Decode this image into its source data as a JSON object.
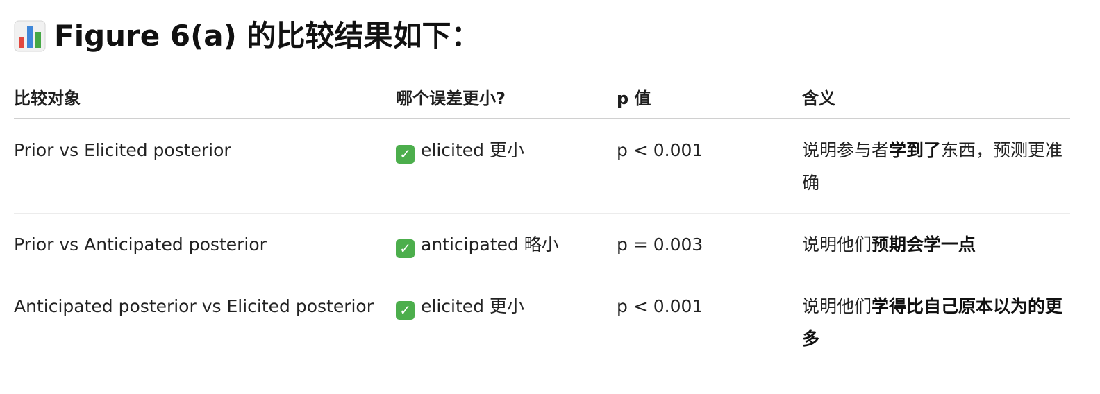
{
  "heading": {
    "icon": "bar-chart-icon",
    "text": "Figure 6(a) 的比较结果如下："
  },
  "table": {
    "headers": [
      "比较对象",
      "哪个误差更小?",
      "p 值",
      "含义"
    ],
    "rows": [
      {
        "comparison": "Prior vs Elicited posterior",
        "smaller_error": "elicited 更小",
        "p_value": "p < 0.001",
        "meaning": {
          "prefix": "说明参与者",
          "bold": "学到了",
          "suffix": "东西，预测更准确"
        }
      },
      {
        "comparison": "Prior vs Anticipated posterior",
        "smaller_error": "anticipated 略小",
        "p_value": "p = 0.003",
        "meaning": {
          "prefix": "说明他们",
          "bold": "预期会学一点",
          "suffix": ""
        }
      },
      {
        "comparison": "Anticipated posterior vs Elicited posterior",
        "smaller_error": "elicited 更小",
        "p_value": "p < 0.001",
        "meaning": {
          "prefix": "说明他们",
          "bold": "学得比自己原本以为的更多",
          "suffix": ""
        }
      }
    ],
    "check_icon": "check-mark-icon",
    "check_color": "#4cae4c"
  }
}
